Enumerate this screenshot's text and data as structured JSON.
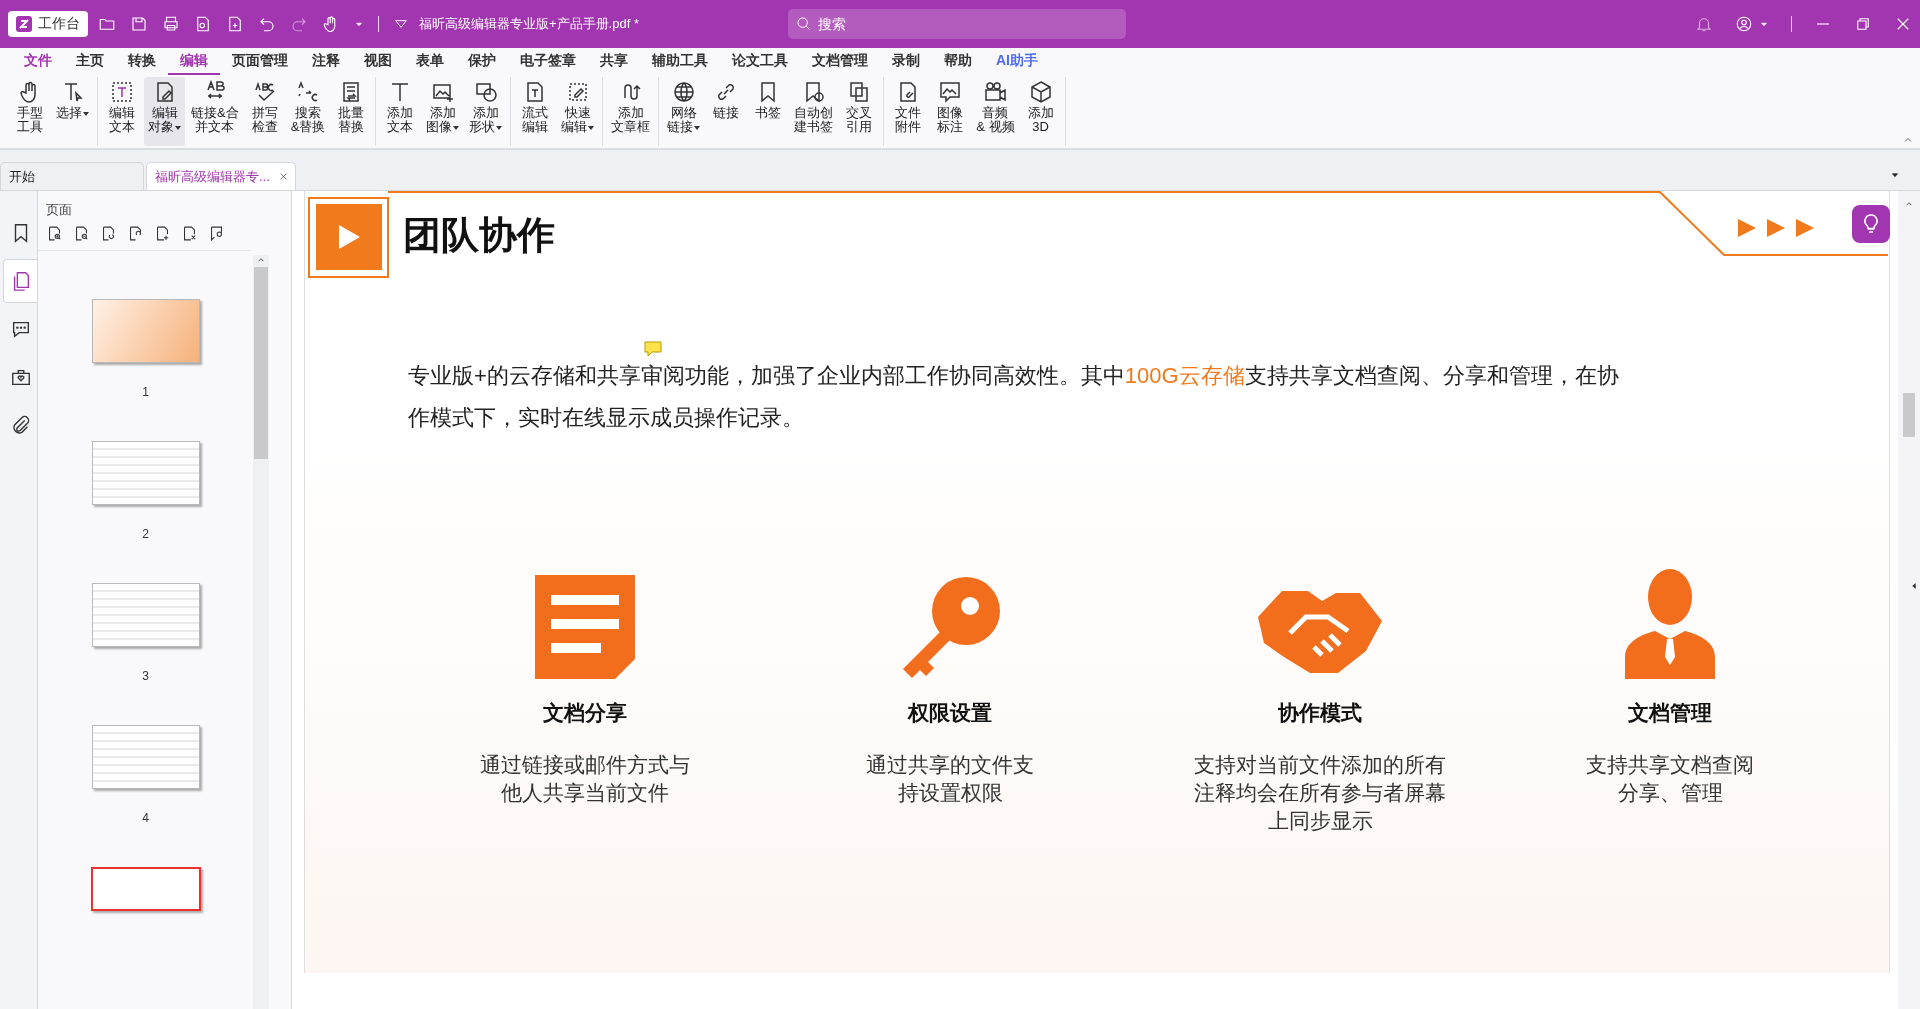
{
  "titlebar": {
    "home_button": "工作台",
    "filename": "福昕高级编辑器专业版+产品手册.pdf *",
    "search": {
      "placeholder": "搜索"
    }
  },
  "menu": [
    {
      "label": "文件",
      "kind": "file",
      "selected": false
    },
    {
      "label": "主页",
      "kind": "normal",
      "selected": false
    },
    {
      "label": "转换",
      "kind": "normal",
      "selected": false
    },
    {
      "label": "编辑",
      "kind": "normal",
      "selected": true
    },
    {
      "label": "页面管理",
      "kind": "normal",
      "selected": false
    },
    {
      "label": "注释",
      "kind": "normal",
      "selected": false
    },
    {
      "label": "视图",
      "kind": "normal",
      "selected": false
    },
    {
      "label": "表单",
      "kind": "normal",
      "selected": false
    },
    {
      "label": "保护",
      "kind": "normal",
      "selected": false
    },
    {
      "label": "电子签章",
      "kind": "normal",
      "selected": false
    },
    {
      "label": "共享",
      "kind": "normal",
      "selected": false
    },
    {
      "label": "辅助工具",
      "kind": "normal",
      "selected": false
    },
    {
      "label": "论文工具",
      "kind": "normal",
      "selected": false
    },
    {
      "label": "文档管理",
      "kind": "normal",
      "selected": false
    },
    {
      "label": "录制",
      "kind": "normal",
      "selected": false
    },
    {
      "label": "帮助",
      "kind": "normal",
      "selected": false
    },
    {
      "label": "AI助手",
      "kind": "ai",
      "selected": false
    }
  ],
  "ribbon": [
    [
      {
        "lines": [
          "手型",
          "工具"
        ],
        "dropdown": false,
        "selected": false
      },
      {
        "lines": [
          "选择"
        ],
        "dropdown": true,
        "selected": false
      }
    ],
    [
      {
        "lines": [
          "编辑",
          "文本"
        ],
        "dropdown": false,
        "selected": false
      },
      {
        "lines": [
          "编辑",
          "对象"
        ],
        "dropdown": true,
        "selected": true
      },
      {
        "lines": [
          "链接&合",
          "并文本"
        ],
        "dropdown": false,
        "selected": false
      },
      {
        "lines": [
          "拼写",
          "检查"
        ],
        "dropdown": false,
        "selected": false
      },
      {
        "lines": [
          "搜索",
          "&替换"
        ],
        "dropdown": false,
        "selected": false
      },
      {
        "lines": [
          "批量",
          "替换"
        ],
        "dropdown": false,
        "selected": false
      }
    ],
    [
      {
        "lines": [
          "添加",
          "文本"
        ],
        "dropdown": false,
        "selected": false
      },
      {
        "lines": [
          "添加",
          "图像"
        ],
        "dropdown": true,
        "selected": false
      },
      {
        "lines": [
          "添加",
          "形状"
        ],
        "dropdown": true,
        "selected": false
      }
    ],
    [
      {
        "lines": [
          "流式",
          "编辑"
        ],
        "dropdown": false,
        "selected": false
      },
      {
        "lines": [
          "快速",
          "编辑"
        ],
        "dropdown": true,
        "selected": false
      }
    ],
    [
      {
        "lines": [
          "添加",
          "文章框"
        ],
        "dropdown": false,
        "selected": false
      }
    ],
    [
      {
        "lines": [
          "网络",
          "链接"
        ],
        "dropdown": true,
        "selected": false
      },
      {
        "lines": [
          "链接"
        ],
        "dropdown": false,
        "selected": false
      },
      {
        "lines": [
          "书签"
        ],
        "dropdown": false,
        "selected": false
      },
      {
        "lines": [
          "自动创",
          "建书签"
        ],
        "dropdown": false,
        "selected": false
      },
      {
        "lines": [
          "交叉",
          "引用"
        ],
        "dropdown": false,
        "selected": false
      }
    ],
    [
      {
        "lines": [
          "文件",
          "附件"
        ],
        "dropdown": false,
        "selected": false
      },
      {
        "lines": [
          "图像",
          "标注"
        ],
        "dropdown": false,
        "selected": false
      },
      {
        "lines": [
          "音频",
          "& 视频"
        ],
        "dropdown": false,
        "selected": false
      },
      {
        "lines": [
          "添加",
          "3D"
        ],
        "dropdown": false,
        "selected": false
      }
    ]
  ],
  "tabs": [
    {
      "label": "开始",
      "selected": false,
      "closable": false
    },
    {
      "label": "福昕高级编辑器专...",
      "selected": true,
      "closable": true
    }
  ],
  "side_nav": [
    {
      "selected": false
    },
    {
      "selected": true
    },
    {
      "selected": false
    },
    {
      "selected": false
    },
    {
      "selected": false
    }
  ],
  "pages_panel": {
    "title": "页面",
    "thumbnails": [
      {
        "label": "1",
        "kind": "cover"
      },
      {
        "label": "2",
        "kind": "page"
      },
      {
        "label": "3",
        "kind": "page"
      },
      {
        "label": "4",
        "kind": "page"
      },
      {
        "kind": "selected"
      }
    ]
  },
  "document": {
    "heading": "团队协作",
    "paragraph": [
      {
        "text": "专业版+的云存储和共享审阅功能，加强了企业内部工作协同高效性。其中",
        "highlight": false
      },
      {
        "text": "100G云存储",
        "highlight": true
      },
      {
        "text": "支持共享文档查阅、分享和管理，在协作模式下，实时在线显示成员操作记录。",
        "highlight": false
      }
    ],
    "features": [
      {
        "kind": "document",
        "title": "文档分享",
        "text": [
          "通过链接或邮件方式与",
          "他人共享当前文件"
        ]
      },
      {
        "kind": "key",
        "title": "权限设置",
        "text": [
          "通过共享的文件支",
          "持设置权限"
        ]
      },
      {
        "kind": "handshake",
        "title": "协作模式",
        "text": [
          "支持对当前文件添加的所有",
          "注释均会在所有参与者屏幕",
          "上同步显示"
        ]
      },
      {
        "kind": "person",
        "title": "文档管理",
        "text": [
          "支持共享文档查阅",
          "分享、管理"
        ]
      }
    ]
  }
}
